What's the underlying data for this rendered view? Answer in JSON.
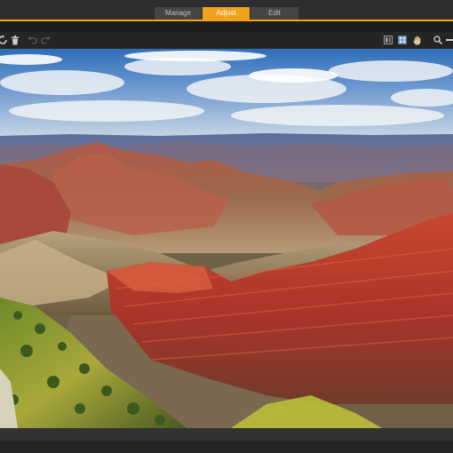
{
  "tabs": [
    {
      "label": "Manage",
      "active": false
    },
    {
      "label": "Adjust",
      "active": true
    },
    {
      "label": "Edit",
      "active": false
    }
  ],
  "toolbar": {
    "left_icons": [
      "rotate-icon",
      "delete-icon",
      "undo-icon",
      "redo-icon"
    ],
    "right_icons": [
      "compare-icon",
      "grid-view-icon",
      "pan-hand-icon",
      "zoom-icon",
      "zoom-slider-icon"
    ]
  },
  "colors": {
    "accent": "#f0a21a",
    "topbar": "#2e2e2e",
    "toolbar": "#252525",
    "tab_inactive": "#454545"
  }
}
